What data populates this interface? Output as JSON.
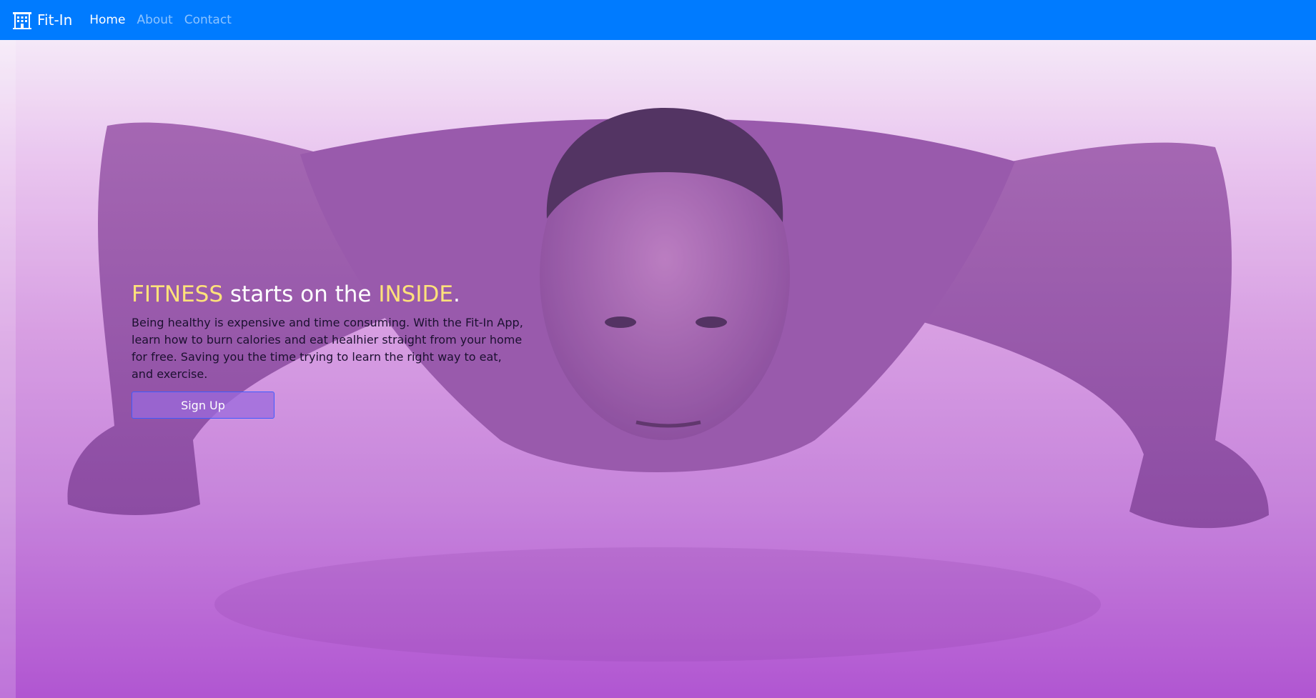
{
  "nav": {
    "brand": "Fit-In",
    "brand_icon": "building-icon",
    "links": [
      {
        "label": "Home",
        "active": true
      },
      {
        "label": "About",
        "active": false
      },
      {
        "label": "Contact",
        "active": false
      }
    ],
    "bg_color": "#007bff"
  },
  "hero": {
    "headline": {
      "word1": "FITNESS",
      "middle": " starts on the ",
      "word2": "INSIDE",
      "end": "."
    },
    "description": "Being healthy is expensive and time consuming. With the Fit-In App, learn how to burn calories and eat healhier straight from your home for free. Saving you the time trying to learn the right way to eat, and exercise.",
    "signup_label": "Sign Up",
    "accent_color": "#ffe27a",
    "image": "man-doing-pushup-purple-overlay"
  }
}
